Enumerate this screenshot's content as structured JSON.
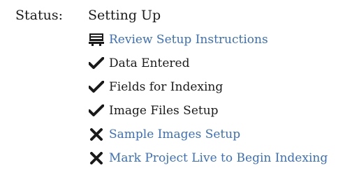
{
  "status": {
    "label": "Status:",
    "value": "Setting Up"
  },
  "steps": [
    {
      "icon": "monitor-icon",
      "label": "Review Setup Instructions",
      "link": true
    },
    {
      "icon": "checkmark-icon",
      "label": "Data Entered",
      "link": false
    },
    {
      "icon": "checkmark-icon",
      "label": "Fields for Indexing",
      "link": false
    },
    {
      "icon": "checkmark-icon",
      "label": "Image Files Setup",
      "link": false
    },
    {
      "icon": "x-mark-icon",
      "label": "Sample Images Setup",
      "link": true
    },
    {
      "icon": "x-mark-icon",
      "label": "Mark Project Live to Begin Indexing",
      "link": true
    }
  ],
  "colors": {
    "text": "#1a1a1a",
    "link": "#3a6fc0",
    "background": "#ffffff"
  }
}
